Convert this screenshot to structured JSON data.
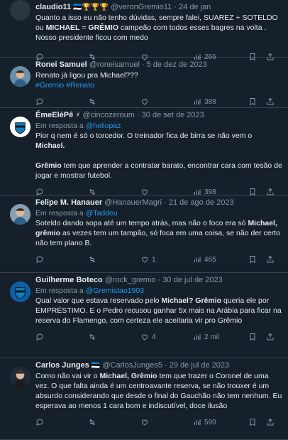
{
  "tweets": [
    {
      "name": "claudio11",
      "badges": "🇪🇪🏆🏆🏆",
      "handle": "@veronGremio11",
      "date": "24 de jan",
      "reply_to": "",
      "body_parts": [
        {
          "t": "Quanto a isso eu não tenho dúvidas, sempre falei, SUAREZ + SOTELDO ou ",
          "b": false
        },
        {
          "t": "MICHAEL",
          "b": true
        },
        {
          "t": " = ",
          "b": false
        },
        {
          "t": "GRÊMIO",
          "b": true
        },
        {
          "t": " campeão com todos esses bagres na volta .  Nosso presidente ficou com medo",
          "b": false
        }
      ],
      "views": "266",
      "reply_count": "",
      "retweet_count": "",
      "like_count": ""
    },
    {
      "name": "Ronei Samuel",
      "badges": "",
      "handle": "@roneisamuel",
      "date": "5 de dez de 2023",
      "reply_to": "",
      "body_parts": [
        {
          "t": "Renato já ligou pra Michael???",
          "b": false
        }
      ],
      "hashtags": "#Gremio #Renato",
      "views": "388",
      "reply_count": "",
      "retweet_count": "",
      "like_count": ""
    },
    {
      "name": "ÉmeEléPê",
      "badges": "⚡",
      "handle": "@cincozeroum",
      "date": "30 de set de 2023",
      "reply_to_prefix": "Em resposta a",
      "reply_to": "@heliopaz",
      "body_parts": [
        {
          "t": "Pior q nem é só o torcedor. O treinador fica de birra se não vem o ",
          "b": false
        },
        {
          "t": "Michael.",
          "b": true
        },
        {
          "t": "\n\n",
          "b": false
        },
        {
          "t": "Grêmio",
          "b": true
        },
        {
          "t": " tem que aprender a contratar barato, encontrar cara com tesão de jogar e mostrar futebol.",
          "b": false
        }
      ],
      "views": "398",
      "reply_count": "",
      "retweet_count": "",
      "like_count": ""
    },
    {
      "name": "Felipe M. Hanauer",
      "badges": "",
      "handle": "@HanauerMagri",
      "date": "21 de ago de 2023",
      "reply_to_prefix": "Em resposta a",
      "reply_to": "@Taddeu",
      "body_parts": [
        {
          "t": "Soteldo dando sopa até um tempo atrás, mas não o foco era só ",
          "b": false
        },
        {
          "t": "Michael, grêmio",
          "b": true
        },
        {
          "t": " as vezes tem um tampão, só foca em uma coisa, se não der certo não tem plano B.",
          "b": false
        }
      ],
      "views": "465",
      "reply_count": "",
      "retweet_count": "",
      "like_count": "1"
    },
    {
      "name": "Guilherme Boteco",
      "badges": "",
      "handle": "@rock_gremio",
      "date": "30 de jul de 2023",
      "reply_to_prefix": "Em resposta a",
      "reply_to": "@Gremistao1903",
      "body_parts": [
        {
          "t": "Qual valor que estava reservado pelo ",
          "b": false
        },
        {
          "t": "Michael? Grêmio",
          "b": true
        },
        {
          "t": " queria ele por EMPRÉSTIMO. E o Pedro recusou ganhar 5x mais na Arábia para ficar na reserva do Flamengo, com certeza ele aceitaria vir pro Grêmio",
          "b": false
        }
      ],
      "views": "2 mil",
      "reply_count": "",
      "retweet_count": "",
      "like_count": "4"
    },
    {
      "name": "Carlos Junges",
      "badges": "🇪🇪",
      "handle": "@CarlosJunges5",
      "date": "29 de jul de 2023",
      "reply_to": "",
      "body_parts": [
        {
          "t": "Como não vai vir o ",
          "b": false
        },
        {
          "t": "Michael, Grêmio",
          "b": true
        },
        {
          "t": " tem que trazer o Coronel de uma vez. O que falta ainda é um centroavante reserva, se não trouxer é um absurdo considerando que desde o final do Gauchão não tem nenhum. Eu esperava ao menos 1 cara bom e indiscutível, doce ilusão",
          "b": false
        }
      ],
      "views": "590",
      "reply_count": "",
      "retweet_count": "",
      "like_count": ""
    }
  ],
  "icons": {
    "reply": "reply-icon",
    "retweet": "retweet-icon",
    "like": "heart-icon",
    "views": "views-icon",
    "bookmark": "bookmark-icon",
    "share": "share-icon"
  },
  "colors": {
    "background": "#15202b",
    "text": "#e7e9ea",
    "muted": "#8b98a5",
    "link": "#1d9bf0",
    "divider": "#38444d"
  }
}
